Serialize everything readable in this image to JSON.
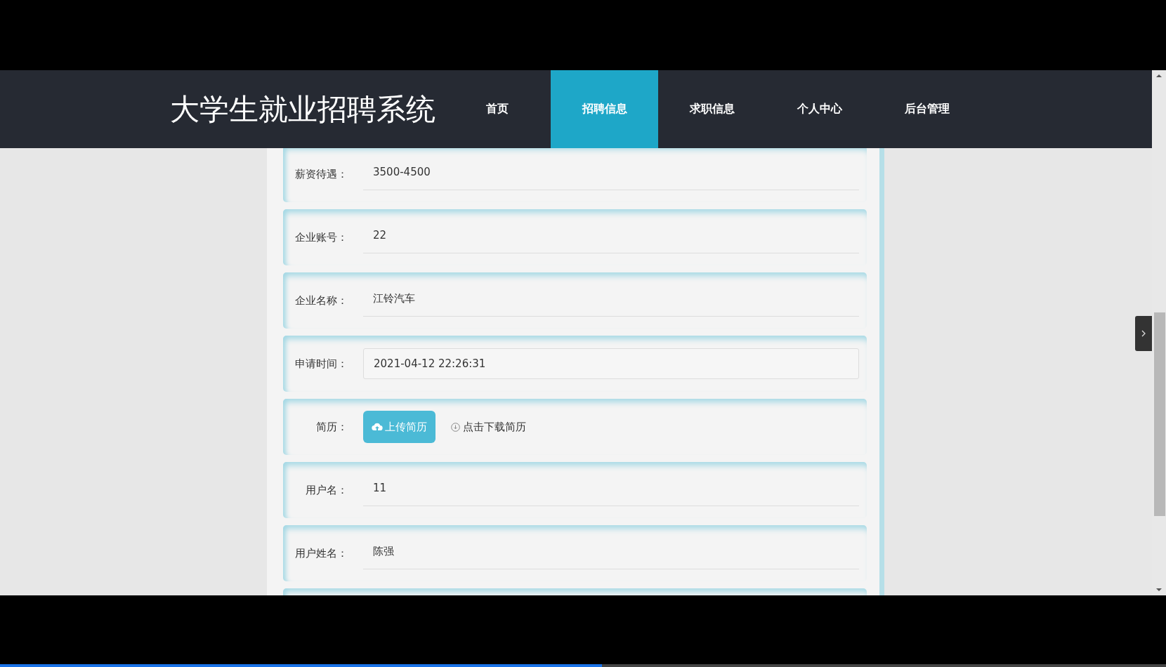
{
  "header": {
    "title": "大学生就业招聘系统"
  },
  "nav": [
    {
      "label": "首页",
      "selected": false
    },
    {
      "label": "招聘信息",
      "selected": true
    },
    {
      "label": "求职信息",
      "selected": false
    },
    {
      "label": "个人中心",
      "selected": false
    },
    {
      "label": "后台管理",
      "selected": false
    }
  ],
  "form": [
    {
      "kind": "text",
      "label": "薪资待遇：",
      "value": "3500-4500"
    },
    {
      "kind": "text",
      "label": "企业账号：",
      "value": "22"
    },
    {
      "kind": "text",
      "label": "企业名称：",
      "value": "江铃汽车"
    },
    {
      "kind": "input",
      "label": "申请时间：",
      "value": "2021-04-12 22:26:31"
    },
    {
      "kind": "upload",
      "label": "简历：",
      "button": "上传简历",
      "link": "点击下载简历"
    },
    {
      "kind": "text",
      "label": "用户名：",
      "value": "11"
    },
    {
      "kind": "text",
      "label": "用户姓名：",
      "value": "陈强"
    },
    {
      "kind": "empty"
    }
  ],
  "video_progress": {
    "level": 0.516
  }
}
